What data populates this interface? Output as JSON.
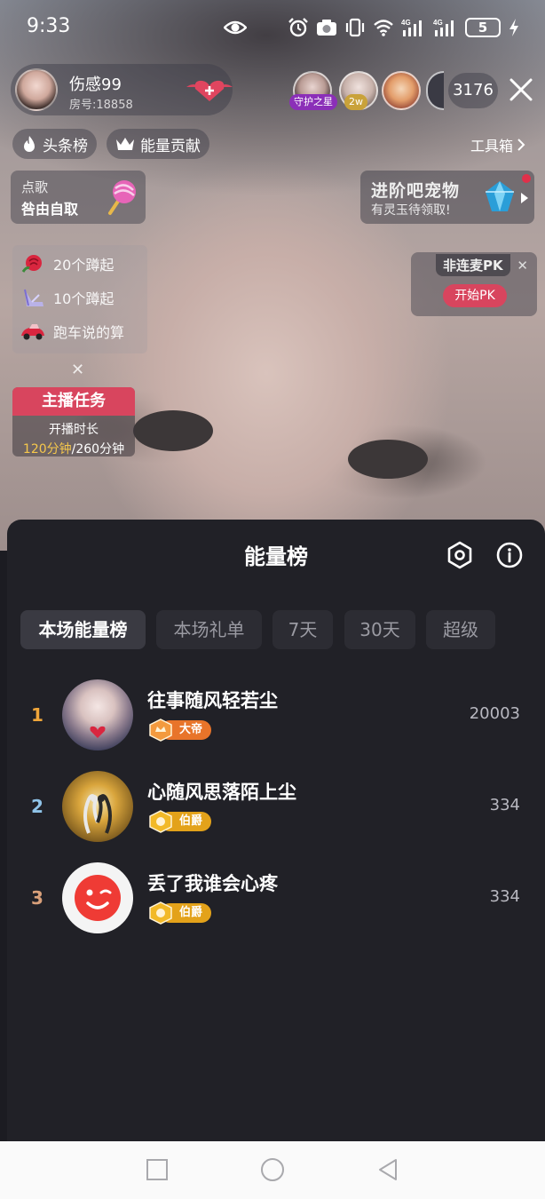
{
  "status_bar": {
    "time": "9:33",
    "battery": "5",
    "icons": [
      "eye-icon",
      "alarm-icon",
      "camera-icon",
      "vibrate-icon",
      "wifi-icon",
      "signal-4g-icon",
      "signal-4g-icon",
      "battery-icon",
      "charging-icon"
    ]
  },
  "host": {
    "name": "伤感99",
    "room": "房号:18858"
  },
  "viewers": {
    "badge_guard": "守护之星",
    "badge_2w": "2w",
    "count": "3176"
  },
  "chips": {
    "headline": "头条榜",
    "energy": "能量贡献",
    "toolbox": "工具箱"
  },
  "song": {
    "label": "点歌",
    "sub": "咎由自取"
  },
  "pet": {
    "title": "进阶吧宠物",
    "sub": "有灵玉待领取!"
  },
  "gift_list": [
    {
      "text": "20个蹲起",
      "icon": "rose-icon"
    },
    {
      "text": "10个蹲起",
      "icon": "crystal-shoe-icon"
    },
    {
      "text": "跑车说的算",
      "icon": "sports-car-icon"
    }
  ],
  "task": {
    "title": "主播任务",
    "line1": "开播时长",
    "done": "120分钟",
    "total": "/260分钟"
  },
  "pk": {
    "title": "非连麦PK",
    "button": "开始PK"
  },
  "sheet": {
    "title": "能量榜",
    "tabs": [
      "本场能量榜",
      "本场礼单",
      "7天",
      "30天",
      "超级"
    ],
    "active_tab": 0
  },
  "ranking": [
    {
      "rank": "1",
      "name": "往事随风轻若尘",
      "badge": "大帝",
      "score": "20003",
      "rank_color": "#f0a63a",
      "badge_color": "#e8742a"
    },
    {
      "rank": "2",
      "name": "心随风思落陌上尘",
      "badge": "伯爵",
      "score": "334",
      "rank_color": "#8fc3e8",
      "badge_color": "#e3a21a"
    },
    {
      "rank": "3",
      "name": "丢了我谁会心疼",
      "badge": "伯爵",
      "score": "334",
      "rank_color": "#d9a07a",
      "badge_color": "#e3a21a"
    }
  ]
}
